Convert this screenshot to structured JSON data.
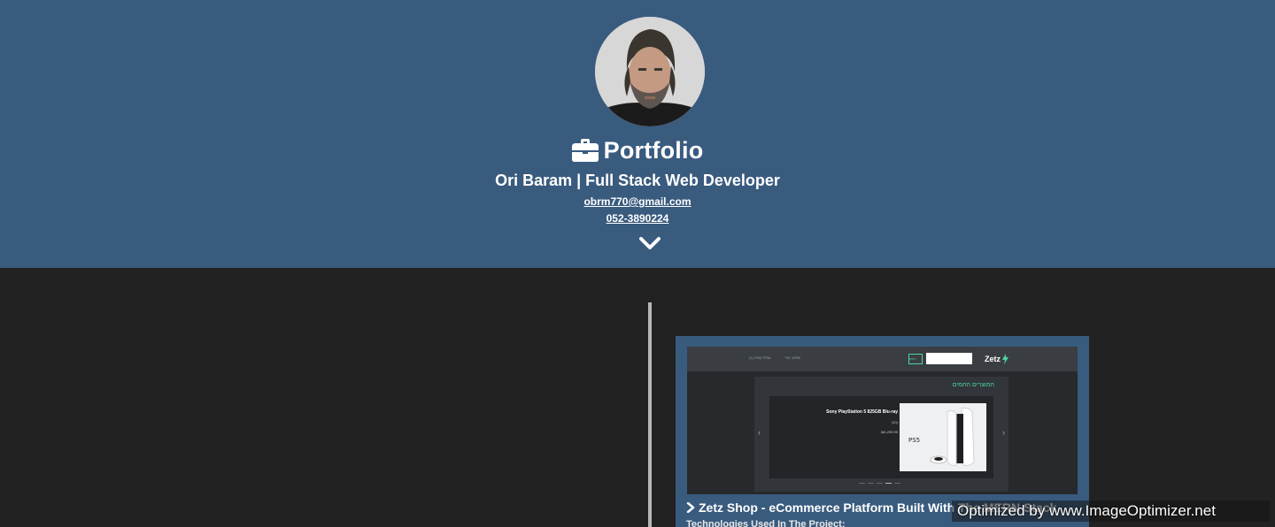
{
  "header": {
    "title": "Portfolio",
    "subtitle": "Ori Baram | Full Stack Web Developer",
    "email": "obrm770@gmail.com",
    "phone": "052-3890224",
    "background_color": "#395b7e",
    "title_icon": "briefcase-icon",
    "scroll_icon": "chevron-down-icon"
  },
  "timeline": {
    "line_color": "#b8b8b8"
  },
  "project_card": {
    "title": "Zetz Shop - eCommerce Platform Built With The MERN Stack",
    "subtitle": "Technologies Used In The Project:",
    "screenshot": {
      "logo": "Zetz",
      "search_button": "חיפוש",
      "heading": "המוצרים החמים",
      "product_name": "Sony PlayStation 5 825GB Blu-ray",
      "product_meta": "(10)",
      "product_price": "₪4,299.99",
      "cart": "(1) עגלת קניות",
      "user": "שלום, אורי"
    }
  },
  "watermark": {
    "text": "Optimized by www.ImageOptimizer.net"
  }
}
